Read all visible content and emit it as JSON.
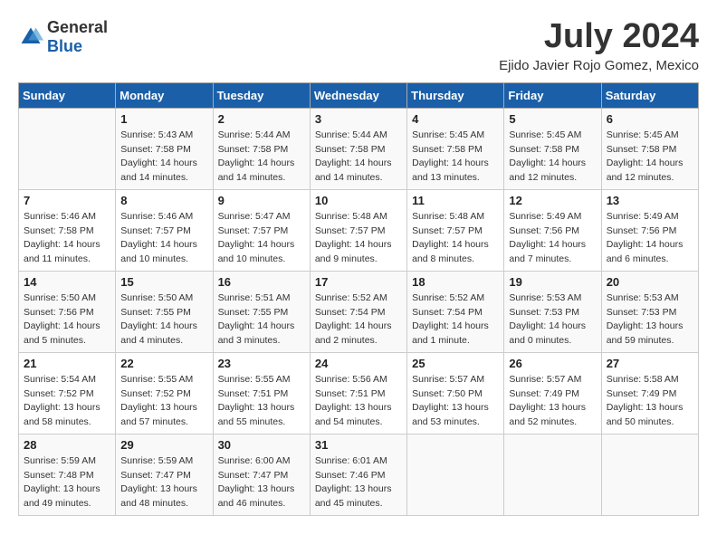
{
  "header": {
    "logo_general": "General",
    "logo_blue": "Blue",
    "month": "July 2024",
    "location": "Ejido Javier Rojo Gomez, Mexico"
  },
  "days_of_week": [
    "Sunday",
    "Monday",
    "Tuesday",
    "Wednesday",
    "Thursday",
    "Friday",
    "Saturday"
  ],
  "weeks": [
    [
      {
        "day": "",
        "info": ""
      },
      {
        "day": "1",
        "info": "Sunrise: 5:43 AM\nSunset: 7:58 PM\nDaylight: 14 hours\nand 14 minutes."
      },
      {
        "day": "2",
        "info": "Sunrise: 5:44 AM\nSunset: 7:58 PM\nDaylight: 14 hours\nand 14 minutes."
      },
      {
        "day": "3",
        "info": "Sunrise: 5:44 AM\nSunset: 7:58 PM\nDaylight: 14 hours\nand 14 minutes."
      },
      {
        "day": "4",
        "info": "Sunrise: 5:45 AM\nSunset: 7:58 PM\nDaylight: 14 hours\nand 13 minutes."
      },
      {
        "day": "5",
        "info": "Sunrise: 5:45 AM\nSunset: 7:58 PM\nDaylight: 14 hours\nand 12 minutes."
      },
      {
        "day": "6",
        "info": "Sunrise: 5:45 AM\nSunset: 7:58 PM\nDaylight: 14 hours\nand 12 minutes."
      }
    ],
    [
      {
        "day": "7",
        "info": "Sunrise: 5:46 AM\nSunset: 7:58 PM\nDaylight: 14 hours\nand 11 minutes."
      },
      {
        "day": "8",
        "info": "Sunrise: 5:46 AM\nSunset: 7:57 PM\nDaylight: 14 hours\nand 10 minutes."
      },
      {
        "day": "9",
        "info": "Sunrise: 5:47 AM\nSunset: 7:57 PM\nDaylight: 14 hours\nand 10 minutes."
      },
      {
        "day": "10",
        "info": "Sunrise: 5:48 AM\nSunset: 7:57 PM\nDaylight: 14 hours\nand 9 minutes."
      },
      {
        "day": "11",
        "info": "Sunrise: 5:48 AM\nSunset: 7:57 PM\nDaylight: 14 hours\nand 8 minutes."
      },
      {
        "day": "12",
        "info": "Sunrise: 5:49 AM\nSunset: 7:56 PM\nDaylight: 14 hours\nand 7 minutes."
      },
      {
        "day": "13",
        "info": "Sunrise: 5:49 AM\nSunset: 7:56 PM\nDaylight: 14 hours\nand 6 minutes."
      }
    ],
    [
      {
        "day": "14",
        "info": "Sunrise: 5:50 AM\nSunset: 7:56 PM\nDaylight: 14 hours\nand 5 minutes."
      },
      {
        "day": "15",
        "info": "Sunrise: 5:50 AM\nSunset: 7:55 PM\nDaylight: 14 hours\nand 4 minutes."
      },
      {
        "day": "16",
        "info": "Sunrise: 5:51 AM\nSunset: 7:55 PM\nDaylight: 14 hours\nand 3 minutes."
      },
      {
        "day": "17",
        "info": "Sunrise: 5:52 AM\nSunset: 7:54 PM\nDaylight: 14 hours\nand 2 minutes."
      },
      {
        "day": "18",
        "info": "Sunrise: 5:52 AM\nSunset: 7:54 PM\nDaylight: 14 hours\nand 1 minute."
      },
      {
        "day": "19",
        "info": "Sunrise: 5:53 AM\nSunset: 7:53 PM\nDaylight: 14 hours\nand 0 minutes."
      },
      {
        "day": "20",
        "info": "Sunrise: 5:53 AM\nSunset: 7:53 PM\nDaylight: 13 hours\nand 59 minutes."
      }
    ],
    [
      {
        "day": "21",
        "info": "Sunrise: 5:54 AM\nSunset: 7:52 PM\nDaylight: 13 hours\nand 58 minutes."
      },
      {
        "day": "22",
        "info": "Sunrise: 5:55 AM\nSunset: 7:52 PM\nDaylight: 13 hours\nand 57 minutes."
      },
      {
        "day": "23",
        "info": "Sunrise: 5:55 AM\nSunset: 7:51 PM\nDaylight: 13 hours\nand 55 minutes."
      },
      {
        "day": "24",
        "info": "Sunrise: 5:56 AM\nSunset: 7:51 PM\nDaylight: 13 hours\nand 54 minutes."
      },
      {
        "day": "25",
        "info": "Sunrise: 5:57 AM\nSunset: 7:50 PM\nDaylight: 13 hours\nand 53 minutes."
      },
      {
        "day": "26",
        "info": "Sunrise: 5:57 AM\nSunset: 7:49 PM\nDaylight: 13 hours\nand 52 minutes."
      },
      {
        "day": "27",
        "info": "Sunrise: 5:58 AM\nSunset: 7:49 PM\nDaylight: 13 hours\nand 50 minutes."
      }
    ],
    [
      {
        "day": "28",
        "info": "Sunrise: 5:59 AM\nSunset: 7:48 PM\nDaylight: 13 hours\nand 49 minutes."
      },
      {
        "day": "29",
        "info": "Sunrise: 5:59 AM\nSunset: 7:47 PM\nDaylight: 13 hours\nand 48 minutes."
      },
      {
        "day": "30",
        "info": "Sunrise: 6:00 AM\nSunset: 7:47 PM\nDaylight: 13 hours\nand 46 minutes."
      },
      {
        "day": "31",
        "info": "Sunrise: 6:01 AM\nSunset: 7:46 PM\nDaylight: 13 hours\nand 45 minutes."
      },
      {
        "day": "",
        "info": ""
      },
      {
        "day": "",
        "info": ""
      },
      {
        "day": "",
        "info": ""
      }
    ]
  ]
}
